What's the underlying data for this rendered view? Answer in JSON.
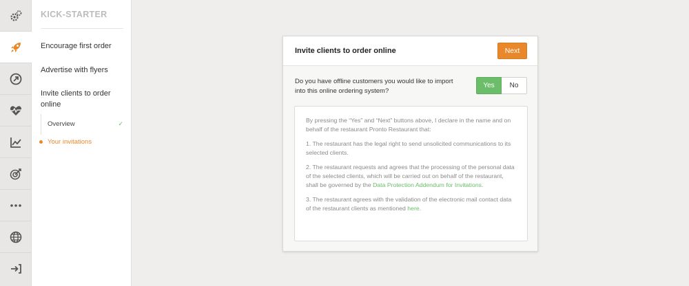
{
  "colors": {
    "accent": "#e8882a",
    "green": "#6cbd6a",
    "muted": "#bdbcba"
  },
  "rail": {
    "icons": [
      "gears-icon",
      "rocket-icon",
      "arrow-circle-icon",
      "heart-pulse-icon",
      "trend-chart-icon",
      "target-icon",
      "more-dots-icon",
      "globe-icon",
      "sign-in-icon"
    ],
    "active_index": 1
  },
  "nav": {
    "title": "KICK-STARTER",
    "items": [
      {
        "label": "Encourage first order"
      },
      {
        "label": "Advertise with flyers"
      },
      {
        "label": "Invite clients to order online"
      }
    ],
    "subitems": [
      {
        "label": "Overview",
        "done": "✓"
      },
      {
        "label": "Your invitations"
      }
    ]
  },
  "card": {
    "title": "Invite clients to order online",
    "next_label": "Next",
    "question": "Do you have offline customers you would like to import into this online ordering system?",
    "yes_label": "Yes",
    "no_label": "No",
    "selected": "Yes",
    "declaration": {
      "intro": "By pressing the “Yes” and “Next” buttons above, I declare in the name and on behalf of the restaurant Pronto Restaurant that:",
      "p1": "1. The restaurant has the legal right to send unsolicited communications to its selected clients.",
      "p2_text": "2. The restaurant requests and agrees that the processing of the personal data of the selected clients, which will be carried out on behalf of the restaurant, shall be governed by the ",
      "p2_link": "Data Protection Addendum for Invitations",
      "p2_end": ".",
      "p3_text": "3. The restaurant agrees with the validation of the electronic mail contact data of the restaurant clients as mentioned ",
      "p3_link": "here",
      "p3_end": "."
    }
  }
}
